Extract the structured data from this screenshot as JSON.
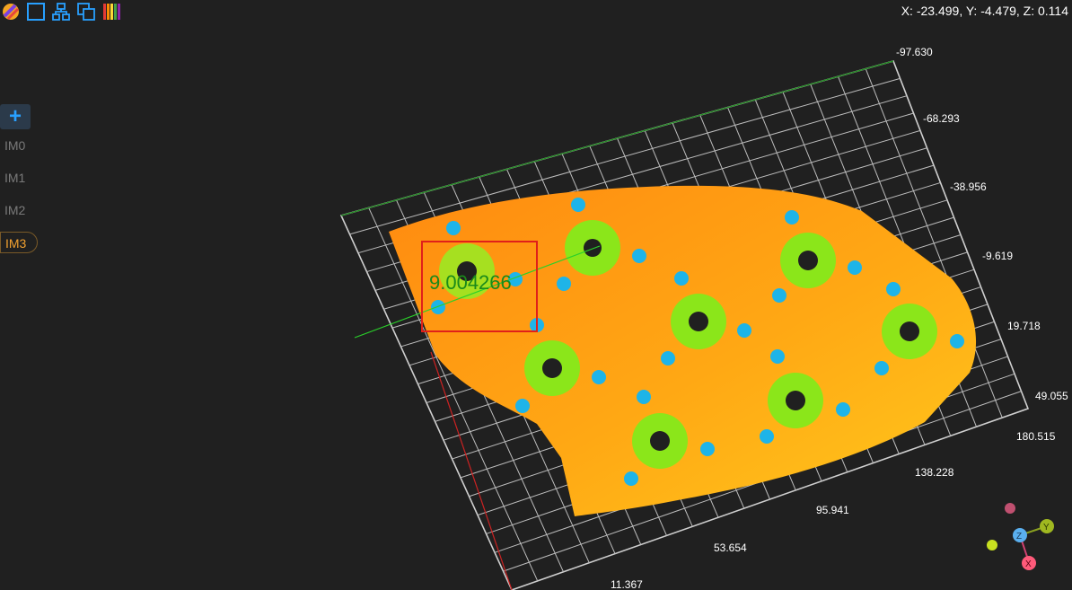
{
  "toolbar": {
    "items": [
      {
        "icon": "color-palette-icon"
      },
      {
        "icon": "bounding-box-icon"
      },
      {
        "icon": "hierarchy-icon"
      },
      {
        "icon": "copy-views-icon"
      },
      {
        "icon": "colormap-bars-icon"
      }
    ]
  },
  "status": {
    "coordinates": "X: -23.499, Y: -4.479, Z: 0.114"
  },
  "sidebar": {
    "add_label": "+",
    "images": [
      {
        "label": "IM0",
        "active": false
      },
      {
        "label": "IM1",
        "active": false
      },
      {
        "label": "IM2",
        "active": false
      },
      {
        "label": "IM3",
        "active": true
      }
    ]
  },
  "viewer": {
    "measurement_value": "9.004266",
    "right_axis_ticks": [
      "-97.630",
      "-68.293",
      "-38.956",
      "-9.619",
      "19.718",
      "49.055"
    ],
    "bottom_axis_ticks": [
      "180.515",
      "138.228",
      "95.941",
      "53.654",
      "11.367"
    ],
    "gizmo": {
      "z": "Z",
      "y": "Y",
      "x": "X"
    },
    "colors": {
      "background": "#202020",
      "surface_orange": "#ff9a10",
      "surface_yellow": "#ffc21a",
      "ring_green": "#8be61a",
      "hole_cyan": "#1eb4e8",
      "measure_box": "#e0201a",
      "measure_text": "#1a8a1a",
      "axis_green": "#1a8a1a",
      "axis_red": "#cc2222"
    }
  }
}
